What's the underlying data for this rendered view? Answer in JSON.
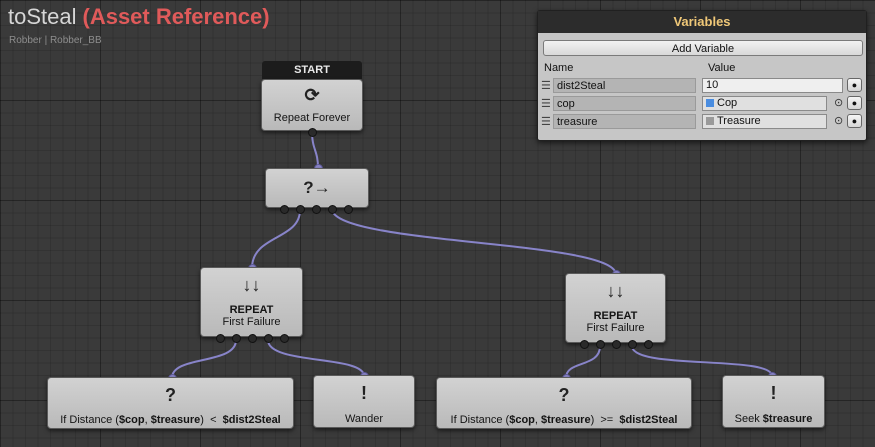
{
  "header": {
    "graph_name": "toSteal",
    "asset_tag": "(Asset Reference)",
    "breadcrumb": "Robber | Robber_BB"
  },
  "nodes": {
    "start": {
      "tag": "START",
      "icon": "repeat-loop-icon",
      "glyph": "⟳",
      "label": "Repeat Forever"
    },
    "selector": {
      "icon": "selector-arrow-icon",
      "glyph": "?→"
    },
    "repeat_left": {
      "icon": "down-arrows-icon",
      "glyph": "↓↓",
      "title": "REPEAT",
      "subtitle": "First Failure"
    },
    "repeat_right": {
      "icon": "down-arrows-icon",
      "glyph": "↓↓",
      "title": "REPEAT",
      "subtitle": "First Failure"
    },
    "condition_left": {
      "glyph": "?",
      "prefix": "If Distance (",
      "arg1": "$cop",
      "sep": ", ",
      "arg2": "$treasure",
      "suffix": ")",
      "op": "<",
      "var": "$dist2Steal"
    },
    "wander": {
      "glyph": "!",
      "label": "Wander"
    },
    "condition_right": {
      "glyph": "?",
      "prefix": "If Distance (",
      "arg1": "$cop",
      "sep": ", ",
      "arg2": "$treasure",
      "suffix": ")",
      "op": ">=",
      "var": "$dist2Steal"
    },
    "seek": {
      "glyph": "!",
      "label_prefix": "Seek",
      "label_var": "$treasure"
    }
  },
  "variables_panel": {
    "title": "Variables",
    "add_button": "Add Variable",
    "col_name": "Name",
    "col_value": "Value",
    "rows": [
      {
        "name": "dist2Steal",
        "value": "10"
      },
      {
        "name": "cop",
        "value": "Cop"
      },
      {
        "name": "treasure",
        "value": "Treasure"
      }
    ],
    "row_button": "●",
    "picker_glyph": "⊙",
    "handle_glyph": "☰"
  },
  "colors": {
    "wire": "#8884c9",
    "background": "#3a3a3a",
    "title_ref": "#e05a5a",
    "panel_header": "#f0c878"
  }
}
